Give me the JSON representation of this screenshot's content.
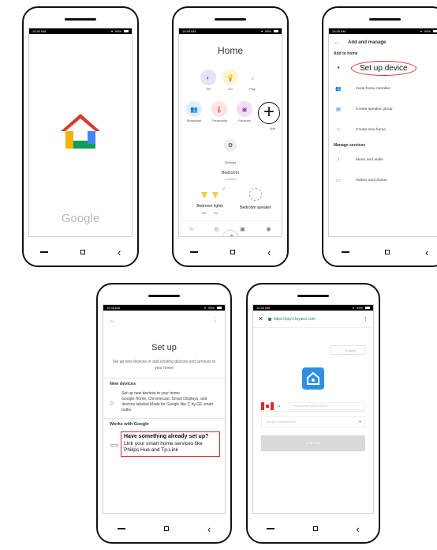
{
  "status": {
    "time": "10:30 AM",
    "battery": "99%"
  },
  "phone1": {
    "google_word": "Google"
  },
  "phone2": {
    "title": "Home",
    "row1": [
      {
        "label": "Off",
        "icon": "lamp-icon",
        "color": "#e8e3f5",
        "fg": "#6a5acd"
      },
      {
        "label": "On",
        "icon": "bulb-icon",
        "color": "#fff4cf",
        "fg": "#e0a800"
      },
      {
        "label": "Play",
        "icon": "music-icon",
        "color": "#ffffff",
        "fg": "#999999"
      }
    ],
    "row2": [
      {
        "label": "Broadcast",
        "icon": "broadcast-icon",
        "color": "#def0f5",
        "fg": "#2a8fb5"
      },
      {
        "label": "Thermostat",
        "icon": "thermostat-icon",
        "color": "#fde3e3",
        "fg": "#d9473a"
      },
      {
        "label": "Routines",
        "icon": "routines-icon",
        "color": "#efe1f5",
        "fg": "#9b3fb5"
      },
      {
        "label": "Add",
        "icon": "add-icon",
        "color": "#ffffff",
        "fg": "#111111"
      }
    ],
    "settings_label": "Settings",
    "bedroom_title": "Bedroom",
    "bedroom_sub": "4 devices",
    "lights_label": "Bedroom lights",
    "lights_count": "2",
    "lights_off": "Off",
    "lights_on": "On",
    "speaker_label": "Bedroom speaker"
  },
  "phone3": {
    "title": "Add and manage",
    "section_add": "Add to home",
    "setup_device": "Set up device",
    "invite": "Invite home member",
    "speaker_group": "Create speaker group",
    "new_home": "Create new home",
    "section_manage": "Manage services",
    "music": "Music and audio",
    "videos": "Videos and photos"
  },
  "phone4": {
    "title": "Set up",
    "subtitle": "Set up new devices or add existing devices and services to your home",
    "section_new": "New devices",
    "new_title": "Set up new devices in your home",
    "new_desc": "Google Home, Chromecast, Smart Displays, and devices labeled Made for Google like C by GE smart bulbs",
    "section_works": "Works with Google",
    "works_title": "Have something already set up?",
    "works_desc": "Link your smart home services like Philips Hue and Tp-Link"
  },
  "phone5": {
    "url": "https://pay1.tuyaeu.com",
    "language": "English",
    "country_code": "+1",
    "phone_placeholder": "Please enter phone number",
    "password_placeholder": "Type your password here",
    "button": "Link Now"
  }
}
